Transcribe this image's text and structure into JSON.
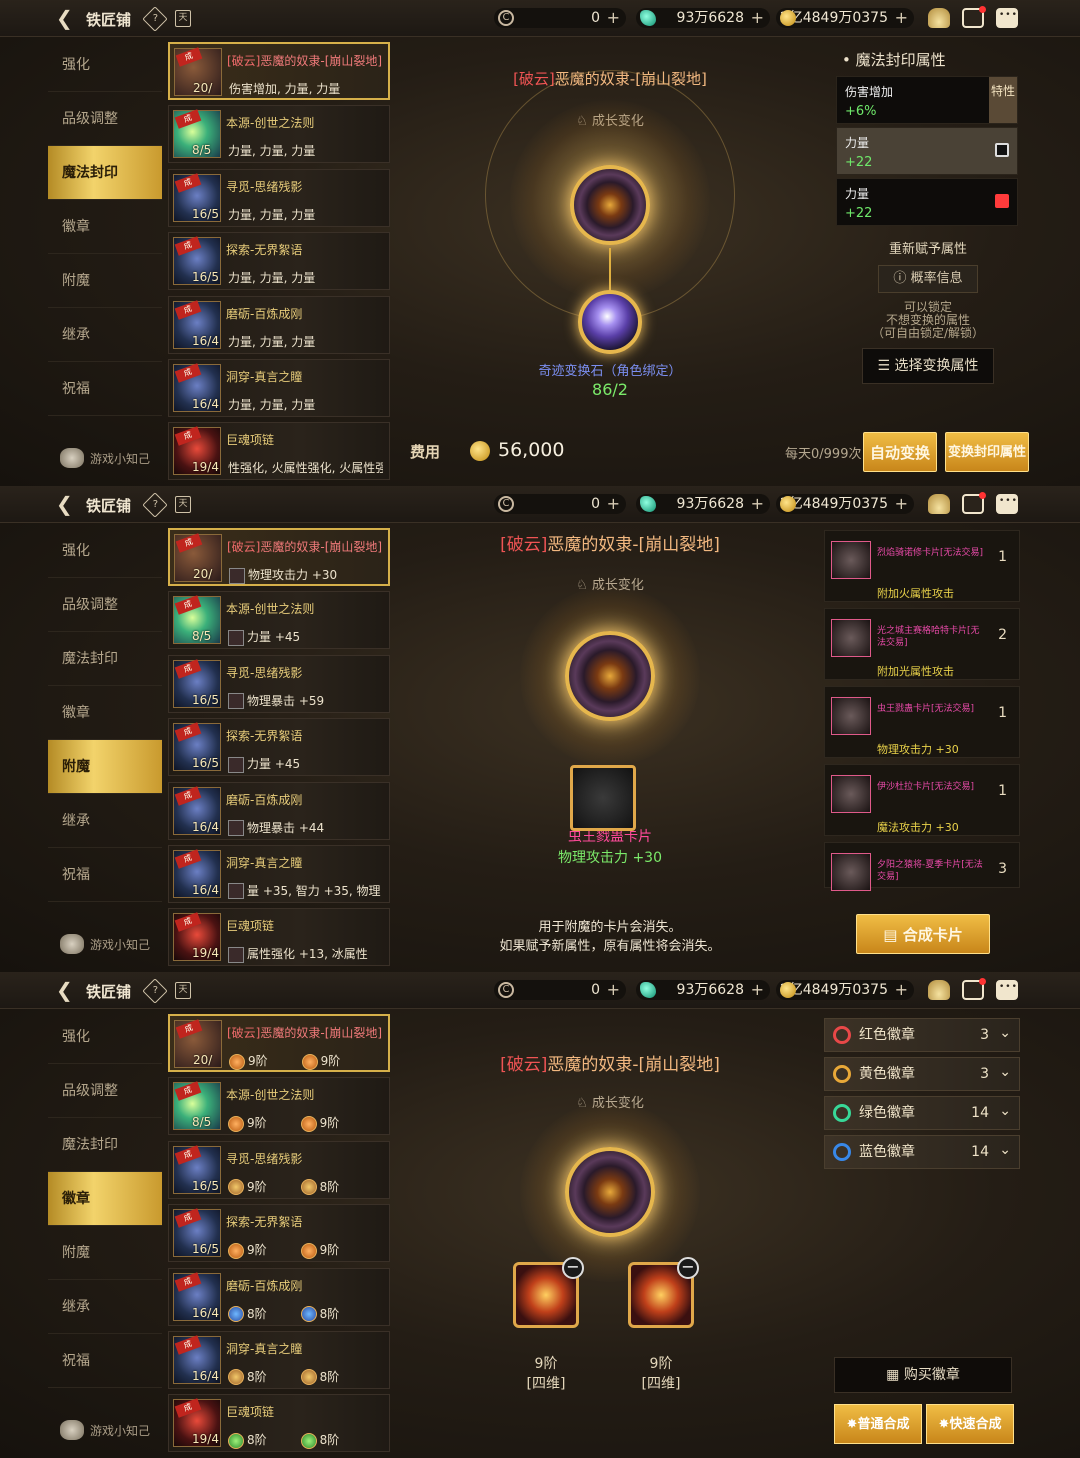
{
  "topbar": {
    "title": "铁匠铺",
    "help_icon": "?",
    "calendar_icon": "天",
    "currency1": "0",
    "currency2": "93万6628",
    "currency3": "2亿4849万0375",
    "plus": "+"
  },
  "sidebar": {
    "items": [
      "强化",
      "品级调整",
      "魔法封印",
      "徽章",
      "附魔",
      "继承",
      "祝福"
    ],
    "tip": "游戏小知己"
  },
  "equipment": [
    {
      "tag": "[破云]",
      "name": "恶魔的奴隶-[崩山裂地]",
      "level": "20/",
      "seal_sub": "伤害增加, 力量, 力量",
      "enchant_sub": "物理攻击力 +30",
      "medal_a": "9阶",
      "medal_b": "9阶"
    },
    {
      "name": "本源-创世之法则",
      "level": "8/5",
      "seal_sub": "力量, 力量, 力量",
      "enchant_sub": "力量 +45",
      "medal_a": "9阶",
      "medal_b": "9阶"
    },
    {
      "name": "寻觅-思绪残影",
      "level": "16/5",
      "seal_sub": "力量, 力量, 力量",
      "enchant_sub": "物理暴击 +59",
      "medal_a": "9阶",
      "medal_b": "8阶"
    },
    {
      "name": "探索-无界絮语",
      "level": "16/5",
      "seal_sub": "力量, 力量, 力量",
      "enchant_sub": "力量 +45",
      "medal_a": "9阶",
      "medal_b": "9阶"
    },
    {
      "name": "磨砺-百炼成刚",
      "level": "16/4",
      "seal_sub": "力量, 力量, 力量",
      "enchant_sub": "物理暴击 +44",
      "medal_a": "8阶",
      "medal_b": "8阶"
    },
    {
      "name": "洞穿-真言之瞳",
      "level": "16/4",
      "seal_sub": "力量, 力量, 力量",
      "enchant_sub": "量 +35, 智力 +35, 物理",
      "medal_a": "8阶",
      "medal_b": "8阶"
    },
    {
      "name": "巨魂项链",
      "level": "19/4",
      "seal_sub": "性强化, 火属性强化, 火属性强化",
      "enchant_sub": "属性强化 +13, 冰属性",
      "medal_a": "8阶",
      "medal_b": "8阶"
    }
  ],
  "item_title": {
    "tag": "[破云]",
    "name": "恶魔的奴隶-[崩山裂地]"
  },
  "growth": "成长变化",
  "seal": {
    "stone_name": "奇迹变换石（角色绑定）",
    "stone_count": "86/2",
    "cost_label": "费用",
    "cost_value": "56,000",
    "daily": "每天0/999次",
    "auto_btn": "自动变换",
    "change_btn": "变换封印属性",
    "panel_title": "魔法封印属性",
    "props": [
      {
        "name": "伤害增加",
        "value": "+6%",
        "lock": "特性"
      },
      {
        "name": "力量",
        "value": "+22"
      },
      {
        "name": "力量",
        "value": "+22"
      }
    ],
    "reassign": "重新赋予属性",
    "prob_btn": "概率信息",
    "lock_hint": [
      "可以锁定",
      "不想变换的属性",
      "（可自由锁定/解锁）"
    ],
    "select_btn": "选择变换属性"
  },
  "enchant": {
    "card_name": "虫王戮蛊卡片",
    "card_effect": "物理攻击力 +30",
    "notice": [
      "用于附魔的卡片会消失。",
      "如果赋予新属性，原有属性将会消失。"
    ],
    "compose_btn": "合成卡片",
    "cards": [
      {
        "name": "烈焰骑诺修卡片[无法交易]",
        "count": "1",
        "effect": "附加火属性攻击"
      },
      {
        "name": "光之城主赛格哈特卡片[无法交易]",
        "count": "2",
        "effect": "附加光属性攻击"
      },
      {
        "name": "虫王戮蛊卡片[无法交易]",
        "count": "1",
        "effect": "物理攻击力 +30"
      },
      {
        "name": "伊沙杜拉卡片[无法交易]",
        "count": "1",
        "effect": "魔法攻击力 +30"
      },
      {
        "name": "夕阳之猿将-夏季卡片[无法交易]",
        "count": "3",
        "effect": ""
      }
    ]
  },
  "medal": {
    "types": [
      {
        "name": "红色徽章",
        "count": "3",
        "color": "#e84848"
      },
      {
        "name": "黄色徽章",
        "count": "3",
        "color": "#e8a838"
      },
      {
        "name": "绿色徽章",
        "count": "14",
        "color": "#38d898"
      },
      {
        "name": "蓝色徽章",
        "count": "14",
        "color": "#3888e8"
      }
    ],
    "slot1": "9阶",
    "slot1b": "[四维]",
    "slot2": "9阶",
    "slot2b": "[四维]",
    "buy": "购买徽章",
    "normal": "普通合成",
    "fast": "快速合成"
  }
}
